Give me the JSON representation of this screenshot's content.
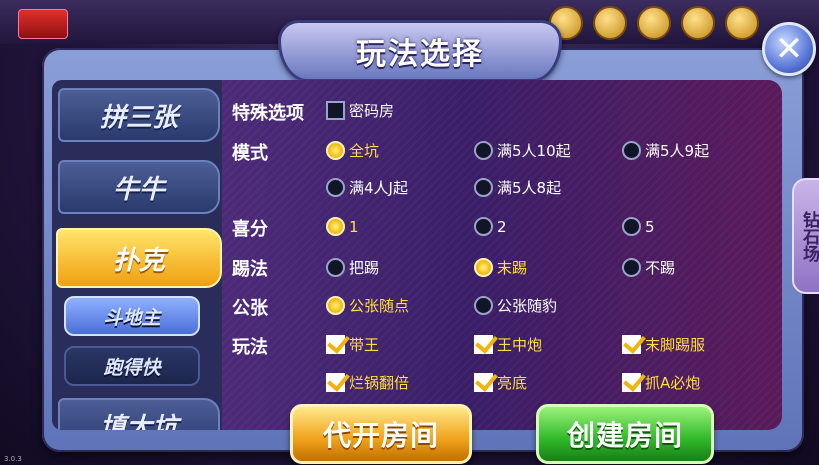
{
  "header": {
    "logo": "",
    "version": "3.0.3"
  },
  "dialog": {
    "title": "玩法选择",
    "close_label": "✕"
  },
  "sidebar": {
    "tabs": [
      {
        "label": "拼三张",
        "active": false
      },
      {
        "label": "牛牛",
        "active": false
      },
      {
        "label": "扑克",
        "active": true
      },
      {
        "label": "填大坑",
        "active": false
      }
    ],
    "subtabs": [
      {
        "label": "斗地主",
        "active": true
      },
      {
        "label": "跑得快",
        "active": false
      }
    ]
  },
  "options": {
    "special": {
      "label": "特殊选项",
      "items": [
        {
          "text": "密码房",
          "checked": false
        }
      ]
    },
    "mode": {
      "label": "模式",
      "items": [
        {
          "text": "全坑",
          "selected": true
        },
        {
          "text": "满5人10起",
          "selected": false
        },
        {
          "text": "满5人9起",
          "selected": false
        },
        {
          "text": "满4人J起",
          "selected": false
        },
        {
          "text": "满5人8起",
          "selected": false
        }
      ]
    },
    "bonus": {
      "label": "喜分",
      "items": [
        {
          "text": "1",
          "selected": true
        },
        {
          "text": "2",
          "selected": false
        },
        {
          "text": "5",
          "selected": false
        }
      ]
    },
    "kick": {
      "label": "踢法",
      "items": [
        {
          "text": "把踢",
          "selected": false
        },
        {
          "text": "末踢",
          "selected": true
        },
        {
          "text": "不踢",
          "selected": false
        }
      ]
    },
    "public_card": {
      "label": "公张",
      "items": [
        {
          "text": "公张随点",
          "selected": true
        },
        {
          "text": "公张随豹",
          "selected": false
        }
      ]
    },
    "play": {
      "label": "玩法",
      "items": [
        {
          "text": "带王",
          "checked": true
        },
        {
          "text": "王中炮",
          "checked": true
        },
        {
          "text": "末脚踢服",
          "checked": true
        },
        {
          "text": "烂锅翻倍",
          "checked": true
        },
        {
          "text": "亮底",
          "checked": true
        },
        {
          "text": "抓A必炮",
          "checked": true
        }
      ]
    }
  },
  "side_shop": {
    "label": "钻石场"
  },
  "buttons": {
    "proxy_room": "代开房间",
    "create_room": "创建房间"
  },
  "colors": {
    "selected_text": "#ffdf3a",
    "accent_gold": "#f0a010",
    "accent_green": "#2fb82a"
  }
}
